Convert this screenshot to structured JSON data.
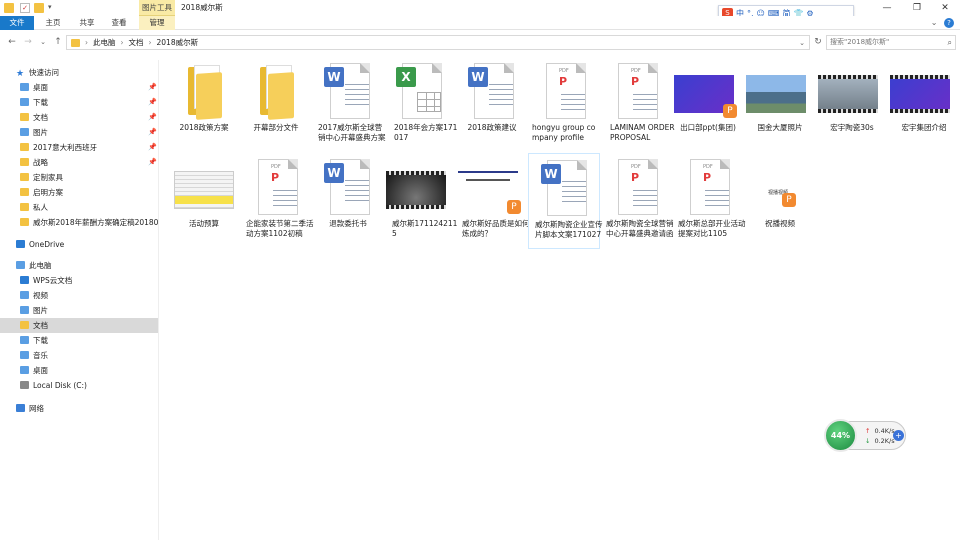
{
  "window": {
    "title": "2018威尔斯",
    "context_tab": "图片工具",
    "controls": {
      "minimize": "—",
      "maximize": "❐",
      "close": "✕"
    }
  },
  "ime_bar": {
    "logo": "S",
    "items": [
      "中",
      "°,",
      "☺",
      "⌨",
      "简",
      "👕",
      "⚙"
    ]
  },
  "ribbon": {
    "tabs": [
      "文件",
      "主页",
      "共享",
      "查看",
      "管理"
    ],
    "expand": "⌄",
    "help": "?"
  },
  "address": {
    "back": "←",
    "forward": "→",
    "recent": "⌄",
    "up": "↑",
    "crumbs": [
      "此电脑",
      "文档",
      "2018威尔斯"
    ],
    "refresh": "↻",
    "search_placeholder": "搜索\"2018威尔斯\""
  },
  "sidebar": {
    "quick_access": "快速访问",
    "quick_items": [
      {
        "label": "桌面",
        "pinned": true
      },
      {
        "label": "下载",
        "pinned": true
      },
      {
        "label": "文档",
        "pinned": true
      },
      {
        "label": "图片",
        "pinned": true
      },
      {
        "label": "2017意大利西班牙",
        "pinned": true
      },
      {
        "label": "战略",
        "pinned": true
      },
      {
        "label": "定制家具",
        "pinned": false
      },
      {
        "label": "启明方案",
        "pinned": false
      },
      {
        "label": "私人",
        "pinned": false
      },
      {
        "label": "威尔斯2018年薪酬方案确定稿20180",
        "pinned": false
      }
    ],
    "onedrive": "OneDrive",
    "this_pc": "此电脑",
    "pc_items": [
      "WPS云文档",
      "视频",
      "图片",
      "文档",
      "下载",
      "音乐",
      "桌面",
      "Local Disk (C:)"
    ],
    "network": "网络",
    "selected": "文档"
  },
  "files": [
    {
      "name": "2018政策方案",
      "kind": "folder"
    },
    {
      "name": "开幕部分文件",
      "kind": "folder"
    },
    {
      "name": "2017威尔斯全球营销中心开幕盛典方案",
      "kind": "word"
    },
    {
      "name": "2018年会方案171017",
      "kind": "excel"
    },
    {
      "name": "2018政策建议",
      "kind": "word"
    },
    {
      "name": "hongyu group company profile",
      "kind": "pdf"
    },
    {
      "name": "LAMINAM ORDER PROPOSAL",
      "kind": "pdf"
    },
    {
      "name": "出口部ppt(集团)",
      "kind": "ppt-image"
    },
    {
      "name": "国金大厦照片",
      "kind": "photo"
    },
    {
      "name": "宏宇陶瓷30s",
      "kind": "video"
    },
    {
      "name": "宏宇集团介绍",
      "kind": "video-ppt"
    },
    {
      "name": "活动预算",
      "kind": "sheet-image"
    },
    {
      "name": "企能家装节第二季活动方案1102初稿",
      "kind": "pdf"
    },
    {
      "name": "退款委托书",
      "kind": "word"
    },
    {
      "name": "威尔斯1711242115",
      "kind": "video"
    },
    {
      "name": "威尔斯好品质是如何炼成的？",
      "kind": "doc-image"
    },
    {
      "name": "威尔斯陶瓷企业宣传片脚本文案171027",
      "kind": "word"
    },
    {
      "name": "威尔斯陶瓷全球营销中心开幕盛典邀请函",
      "kind": "pdf"
    },
    {
      "name": "威尔斯总部开业活动提案对比1105",
      "kind": "pdf"
    },
    {
      "name": "祝播视频",
      "kind": "wps-link"
    }
  ],
  "pdf_label": "PDF",
  "wps_badge": "P",
  "video_thumb_label": "视播视频",
  "network_widget": {
    "percent": "44%",
    "upload": "0.4K/s",
    "download": "0.2K/s",
    "up_arrow": "↑",
    "down_arrow": "↓",
    "add": "+"
  },
  "colors": {
    "accent": "#1979ca",
    "context_tab": "#f9eaa5",
    "folder": "#f3c242",
    "word": "#4472c4",
    "excel": "#3a9a4b",
    "pdf": "#e23b3b",
    "wps": "#f28a30",
    "selected_row": "#d9d9d9",
    "widget_green": "#1c8a3f"
  }
}
